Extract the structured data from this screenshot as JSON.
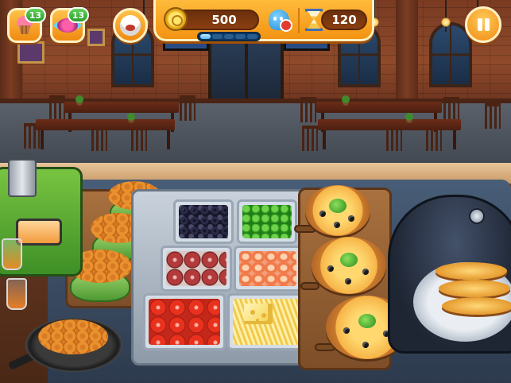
{
  "hud": {
    "cupcake_booster_count": "13",
    "candy_booster_count": "13",
    "coins": "500",
    "level_progress_filled_segments": 1,
    "level_progress_total_segments": 5,
    "timer": "120"
  },
  "icons": {
    "cupcake": "cupcake-icon",
    "candy": "candy-icon",
    "chef": "chef-hat-icon",
    "coin": "coin-icon",
    "customer_status": "ghost-icon",
    "timer": "hourglass-icon",
    "pause": "pause-icon"
  },
  "colors": {
    "hud_orange": "#f39312",
    "badge_green": "#2c9d2a",
    "pill_brown": "#6b2f0c"
  }
}
